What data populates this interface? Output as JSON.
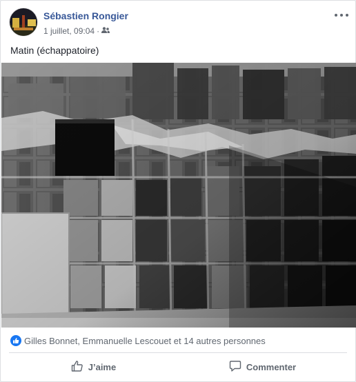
{
  "post": {
    "author": "Sébastien Rongier",
    "timestamp": "1 juillet, 09:04",
    "audience_icon": "friends-icon",
    "caption": "Matin (échappatoire)",
    "photo_alt": "Photo noir et blanc d'un mur carrelé dégradé"
  },
  "reactions": {
    "icon": "like-icon",
    "text": "Gilles Bonnet, Emmanuelle Lescouet et 14 autres personnes"
  },
  "actions": {
    "like_label": "J’aime",
    "comment_label": "Commenter"
  },
  "colors": {
    "author_link": "#385898",
    "like_blue": "#1877f2",
    "secondary_text": "#606770"
  }
}
